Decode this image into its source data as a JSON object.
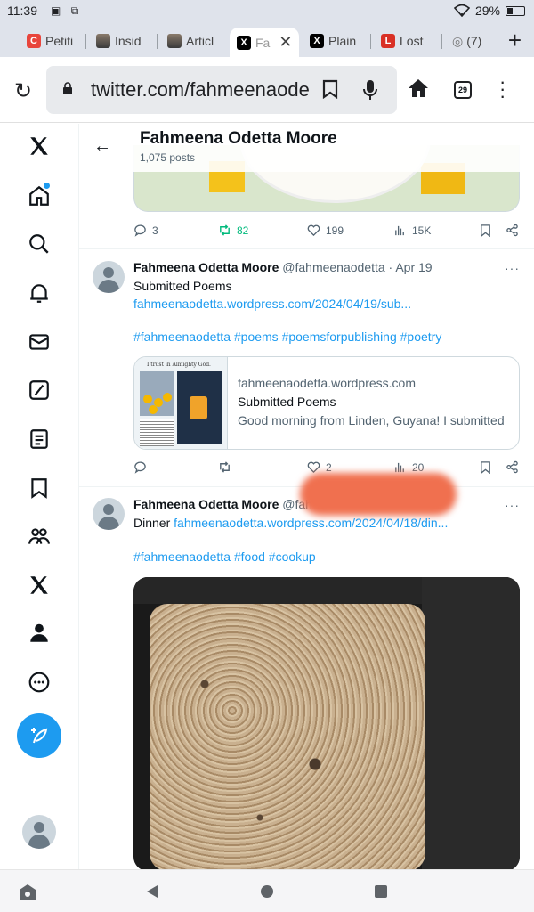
{
  "status_bar": {
    "time": "11:39",
    "battery": "29%"
  },
  "tabs": [
    {
      "label": "Petiti",
      "favicon": "C",
      "color": "#e8453c"
    },
    {
      "label": "Insid",
      "favicon": "img",
      "color": "#555"
    },
    {
      "label": "Articl",
      "favicon": "img",
      "color": "#555"
    },
    {
      "label": "Fa",
      "favicon": "X",
      "color": "#000",
      "active": true
    },
    {
      "label": "Plain",
      "favicon": "X",
      "color": "#000"
    },
    {
      "label": "Lost",
      "favicon": "L",
      "color": "#d93025"
    },
    {
      "label": "(7)",
      "favicon": "globe",
      "color": "#777"
    }
  ],
  "browser": {
    "url": "twitter.com/fahmeenaode",
    "tab_count": "29"
  },
  "sidebar": {
    "items": [
      "home",
      "explore",
      "notifications",
      "messages",
      "grok",
      "lists",
      "bookmarks",
      "communities",
      "premium",
      "profile",
      "more"
    ]
  },
  "header": {
    "name": "Fahmeena Odetta Moore",
    "posts": "1,075 posts"
  },
  "post0": {
    "replies": "3",
    "retweets": "82",
    "likes": "199",
    "views": "15K"
  },
  "post1": {
    "name": "Fahmeena Odetta Moore",
    "handle_time": "@fahmeenaodetta · Apr 19",
    "text": "Submitted Poems",
    "link": "fahmeenaodetta.wordpress.com/2024/04/19/sub...",
    "hashtags": "#fahmeenaodetta #poems #poemsforpublishing #poetry",
    "card": {
      "thumb_title": "I trust in Almighty God.",
      "domain": "fahmeenaodetta.wordpress.com",
      "title": "Submitted Poems",
      "desc": "Good morning from Linden, Guyana! I submitted"
    },
    "replies": "",
    "retweets": "",
    "likes": "2",
    "views": "20"
  },
  "post2": {
    "name": "Fahmeena Odetta Moore",
    "handle": "@fah",
    "text": "Dinner",
    "link": "fahmeenaodetta.wordpress.com/2024/04/18/din...",
    "hashtags": "#fahmeenaodetta #food #cookup"
  },
  "colors": {
    "accent": "#1d9bf0",
    "retweet_green": "#00ba7c"
  }
}
